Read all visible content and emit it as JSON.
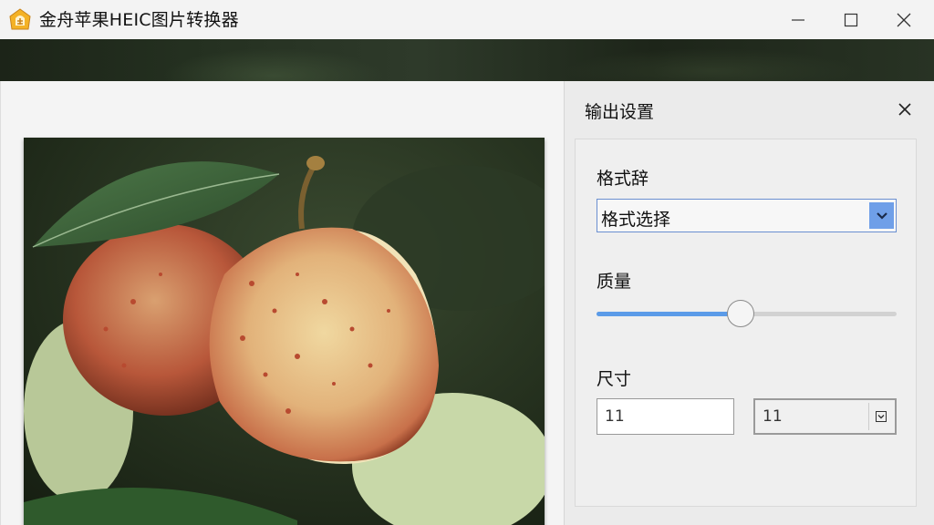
{
  "window": {
    "title": "金舟苹果HEIC图片转换器",
    "icon": "app-logo-icon",
    "controls": [
      "minimize-icon",
      "maximize-icon",
      "close-icon"
    ]
  },
  "preview": {
    "image": "apple-photo"
  },
  "settings_panel": {
    "title": "输出设置",
    "close_icon": "close-icon",
    "format": {
      "label": "格式辞",
      "selected": "格式选择",
      "accent": "#6f9fe8"
    },
    "quality": {
      "label": "质量",
      "value_fraction": 0.48,
      "accent": "#5b9be8"
    },
    "size": {
      "label": "尺寸",
      "width": "11",
      "height": "11"
    }
  }
}
